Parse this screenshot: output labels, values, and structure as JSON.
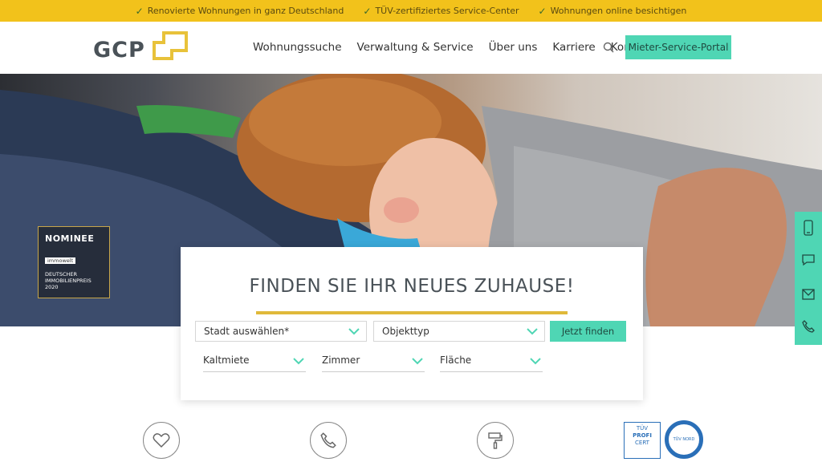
{
  "topbar": {
    "items": [
      "Renovierte Wohnungen in ganz Deutschland",
      "TÜV-zertifiziertes Service-Center",
      "Wohnungen online besichtigen"
    ]
  },
  "header": {
    "logo_text": "GCP",
    "nav": [
      "Wohnungssuche",
      "Verwaltung & Service",
      "Über uns",
      "Karriere",
      "Kontakt"
    ],
    "portal_label": "Mieter-Service-Portal"
  },
  "hero": {
    "badge": {
      "title": "NOMINEE",
      "brand": "immowelt",
      "line1": "DEUTSCHER",
      "line2": "IMMOBILIENPREIS",
      "year": "2020"
    }
  },
  "search": {
    "title": "FINDEN SIE IHR NEUES ZUHAUSE!",
    "city_value": "Stadt auswählen*",
    "type_value": "Objekttyp",
    "submit_label": "Jetzt finden",
    "filters": [
      "Kaltmiete",
      "Zimmer",
      "Fläche"
    ]
  },
  "sidebar_icons": [
    "mobile-icon",
    "chat-icon",
    "mail-icon",
    "phone-icon"
  ],
  "features": [
    "heart-icon",
    "phone-icon",
    "paint-roller-icon"
  ],
  "certs": {
    "tuev1": [
      "TÜV",
      "PROFI",
      "CERT"
    ],
    "tuev2": "TÜV NORD"
  },
  "colors": {
    "accent": "#f2c21b",
    "primary": "#4fd6b4",
    "text": "#4a5258",
    "underline": "#e0b93a"
  }
}
